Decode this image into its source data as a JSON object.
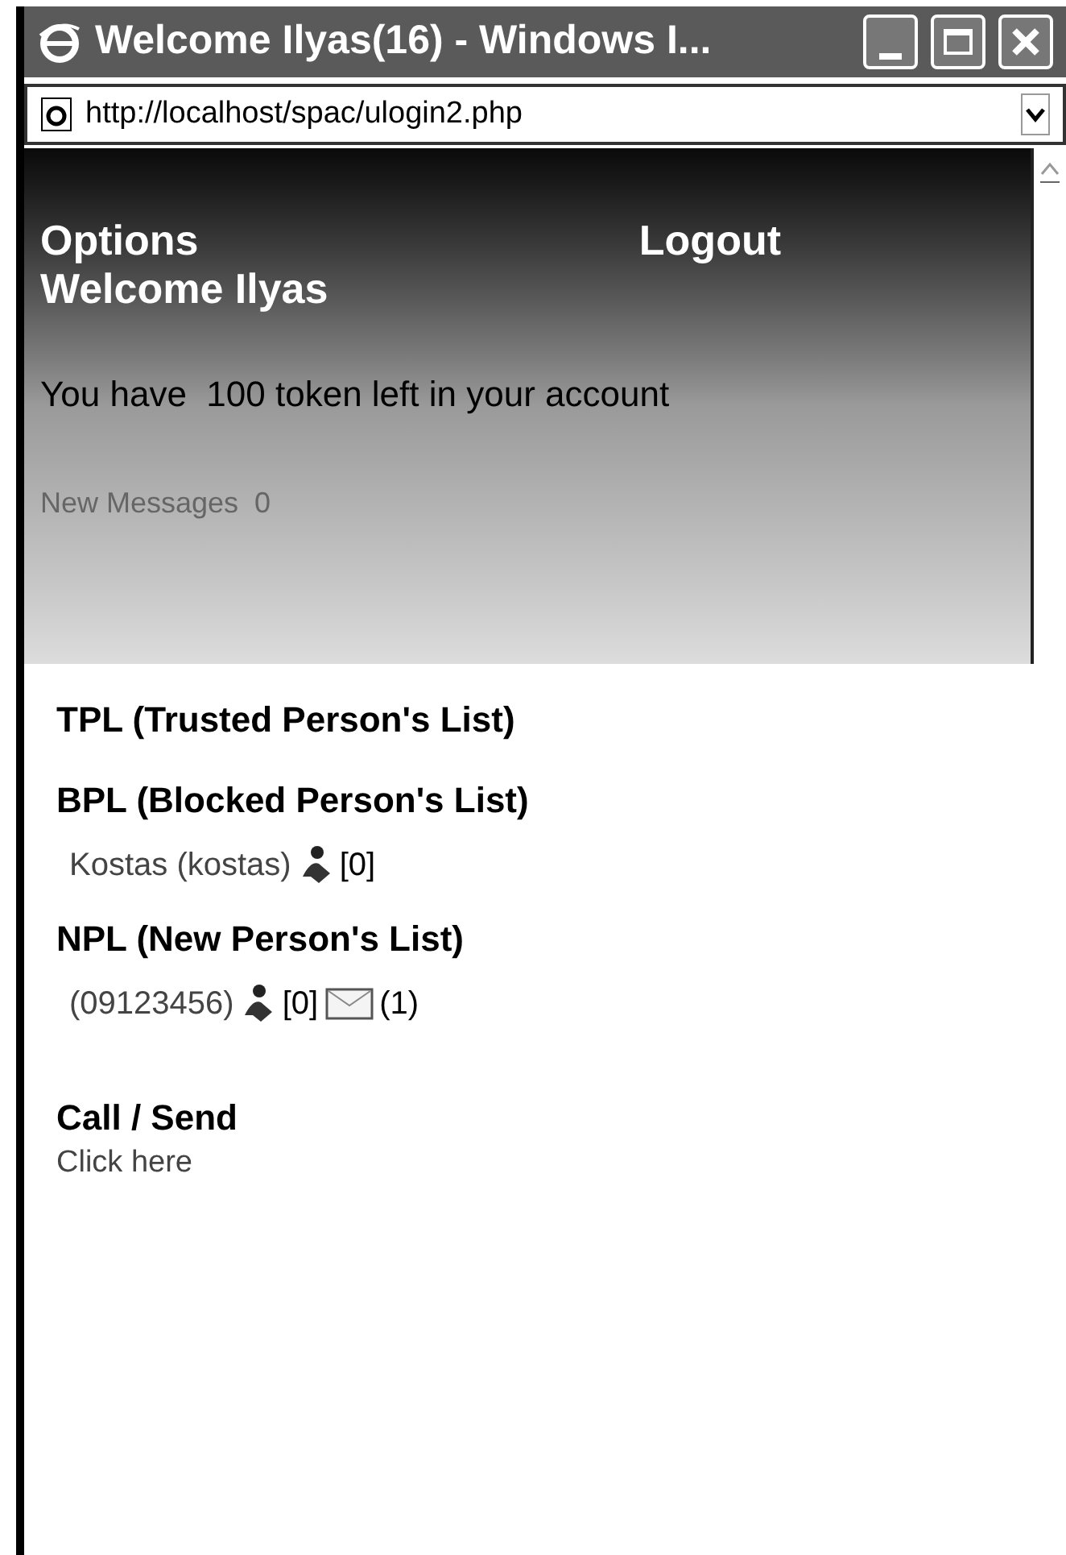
{
  "window": {
    "title": "Welcome Ilyas(16) - Windows I..."
  },
  "address_bar": {
    "url": "http://localhost/spac/ulogin2.php"
  },
  "header": {
    "links": [
      "Options",
      "Logout"
    ],
    "welcome": "Welcome Ilyas"
  },
  "tokens": "You have  100 token left in your account",
  "new_messages": "New Messages  0",
  "lists": [
    {
      "title": "TPL (Trusted Person's List)"
    },
    {
      "title": "BPL (Blocked Person's List)",
      "entries": [
        {
          "label": "Kostas (kostas)",
          "count": "[0]"
        }
      ]
    },
    {
      "title": "NPL (New Person's List)",
      "entries": [
        {
          "label": "(09123456)",
          "count": "[0]",
          "messages": "(1)"
        }
      ]
    }
  ],
  "call_send": {
    "title": "Call / Send",
    "link": "Click here"
  }
}
